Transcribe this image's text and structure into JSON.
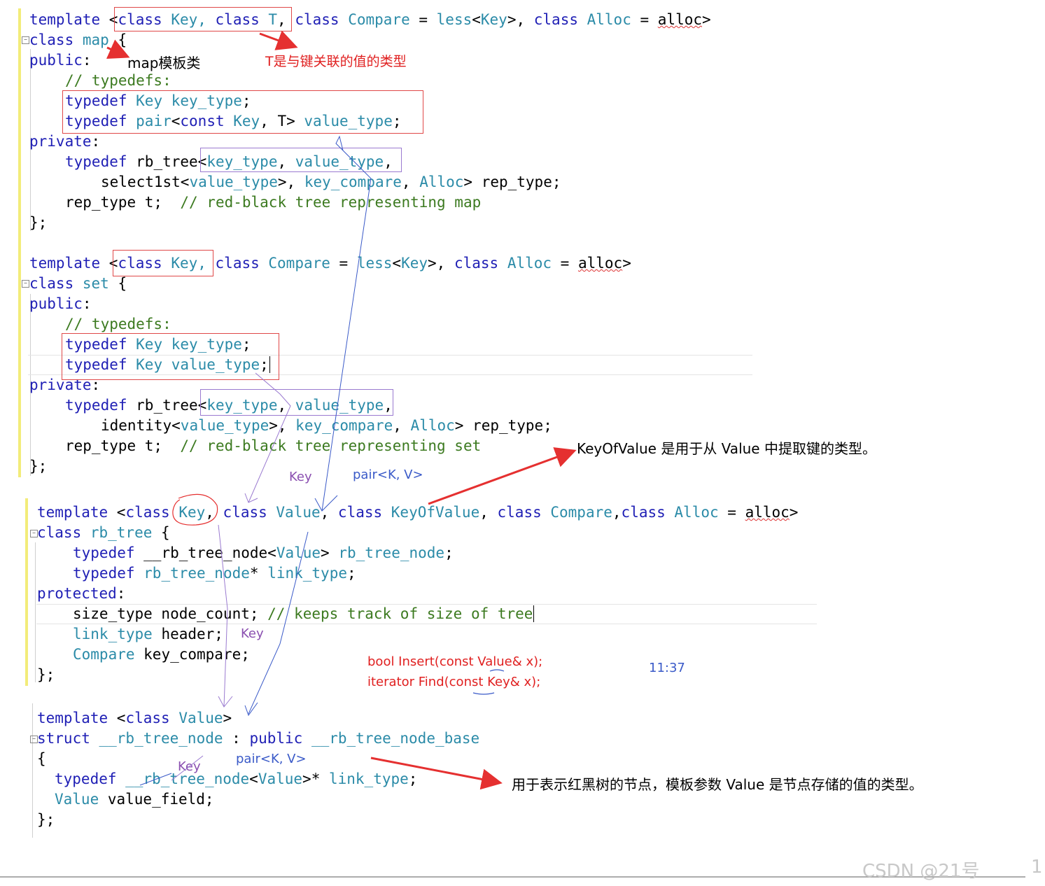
{
  "block1": {
    "l1": {
      "a": "template ",
      "b": "<",
      "c": "class",
      "d": " Key, ",
      "e": "class",
      "f": " T",
      "g": ", ",
      "h": "class",
      "i": " Compare",
      "j": " = ",
      "k": "less",
      "l": "<",
      "m": "Key",
      "n": ">, ",
      "o": "class",
      "p": " Alloc",
      "q": " = ",
      "r": "alloc",
      "s": ">"
    },
    "l2": {
      "a": "class",
      "b": " map",
      "c": " {"
    },
    "l3": {
      "a": "public",
      "b": ":"
    },
    "l4": "// typedefs:",
    "l5": {
      "a": "typedef",
      "b": " Key",
      "c": " key_type",
      "d": ";"
    },
    "l6": {
      "a": "typedef",
      "b": " pair",
      "c": "<",
      "d": "const",
      "e": " Key",
      "f": ", T>",
      "g": " value_type",
      "h": ";"
    },
    "l7": {
      "a": "private",
      "b": ":"
    },
    "l8": {
      "a": "typedef",
      "b": " rb_tree<",
      "c": "key_type",
      "d": ", ",
      "e": "value_type",
      "f": ","
    },
    "l9": {
      "a": "select1st<",
      "b": "value_type",
      "c": ">, ",
      "d": "key_compare",
      "e": ", ",
      "f": "Alloc",
      "g": "> rep_type;"
    },
    "l10": {
      "a": "rep_type t;  ",
      "b": "// red-black tree representing map"
    },
    "l11": "};"
  },
  "block2": {
    "l1": {
      "a": "template ",
      "b": "<",
      "c": "class",
      "d": " Key, ",
      "e": "class",
      "f": " Compare",
      "g": " = ",
      "h": "less",
      "i": "<",
      "j": "Key",
      "k": ">, ",
      "l": "class",
      "m": " Alloc",
      "n": " = ",
      "o": "alloc",
      "p": ">"
    },
    "l2": {
      "a": "class",
      "b": " set",
      "c": " {"
    },
    "l3": {
      "a": "public",
      "b": ":"
    },
    "l4": "// typedefs:",
    "l5": {
      "a": "typedef",
      "b": " Key",
      "c": " key_type",
      "d": ";"
    },
    "l6": {
      "a": "typedef",
      "b": " Key",
      "c": " value_type",
      "d": ";"
    },
    "l7": {
      "a": "private",
      "b": ":"
    },
    "l8": {
      "a": "typedef",
      "b": " rb_tree<",
      "c": "key_type",
      "d": ", ",
      "e": "value_type",
      "f": ","
    },
    "l9": {
      "a": "identity<",
      "b": "value_type",
      "c": ">, ",
      "d": "key_compare",
      "e": ", ",
      "f": "Alloc",
      "g": "> rep_type;"
    },
    "l10": {
      "a": "rep_type t;  ",
      "b": "// red-black tree representing set"
    },
    "l11": "};"
  },
  "block3": {
    "l1": {
      "a": "template ",
      "b": "<",
      "c": "class",
      "d": " Key",
      "e": ", ",
      "f": "class",
      "g": " Value",
      "h": ", ",
      "i": "class",
      "j": " KeyOfValue",
      "k": ", ",
      "l": "class",
      "m": " Compare",
      "n": ",",
      "o": "class",
      "p": " Alloc",
      "q": " = ",
      "r": "alloc",
      "s": ">"
    },
    "l2": {
      "a": "class",
      "b": " rb_tree",
      "c": " {"
    },
    "l3": {
      "a": "typedef",
      "b": " __rb_tree_node<",
      "c": "Value",
      "d": ">",
      "e": " rb_tree_node",
      "f": ";"
    },
    "l4": {
      "a": "typedef",
      "b": " rb_tree_node",
      "c": "*",
      "d": " link_type",
      "e": ";"
    },
    "l5": {
      "a": "protected",
      "b": ":"
    },
    "l6": {
      "a": "size_type node_count; ",
      "b": "// keeps track of size of tree"
    },
    "l7": {
      "a": "link_type",
      "b": " header;"
    },
    "l8": {
      "a": "Compare",
      "b": " key_compare;"
    },
    "l9": "};"
  },
  "block4": {
    "l1": {
      "a": "template ",
      "b": "<",
      "c": "class",
      "d": " Value",
      "e": ">"
    },
    "l2": {
      "a": "struct",
      "b": " __rb_tree_node",
      "c": " : ",
      "d": "public",
      "e": " __rb_tree_node_base"
    },
    "l3": "{",
    "l4": {
      "a": "typedef",
      "b": " __rb_tree_node",
      "c": "<",
      "d": "Value",
      "e": ">*",
      "f": " link_type",
      "g": ";"
    },
    "l5": {
      "a": "Value",
      "b": " value_field;"
    },
    "l6": "};"
  },
  "annotations": {
    "map_template": "map模板类",
    "t_value": "T是与键关联的值的类型",
    "key_label_1": "Key",
    "pair_label_1": "pair<K, V>",
    "key_of_value": "KeyOfValue 是用于从 Value 中提取键的类型。",
    "key_label_2": "Key",
    "bool_insert": "bool Insert(const Value& x);",
    "iterator_find": "iterator Find(const Key& x);",
    "time": "11:37",
    "key_label_3": "Key",
    "pair_label_2": "pair<K, V>",
    "node_desc": "用于表示红黑树的节点，模板参数 Value 是节点存储的值的类型。"
  },
  "watermark": {
    "text": "CSDN @21号",
    "page": "1"
  },
  "colors": {
    "keyword": "#1f1fb5",
    "type": "#2b8ba8",
    "comment": "#3c7a20",
    "red_annotation": "#e02020",
    "purple_annotation": "#8a4fb0",
    "blue_annotation": "#3a5ac8"
  }
}
